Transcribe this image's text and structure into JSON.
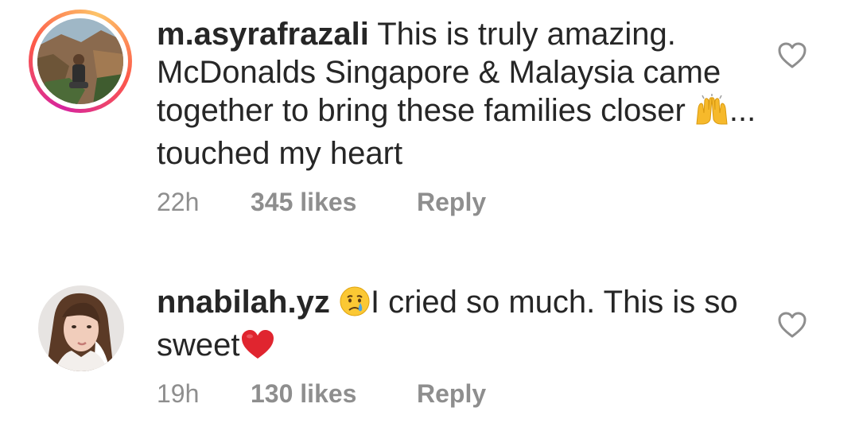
{
  "comments": [
    {
      "username": "m.asyrafrazali",
      "text_before_emoji": "This is truly amazing. McDonalds Singapore & Malaysia came together to bring these families closer ",
      "emoji": "raising-hands-icon",
      "text_after_emoji": "... touched my heart",
      "time": "22h",
      "likes": "345 likes",
      "reply_label": "Reply",
      "has_story_ring": true,
      "like_icon": "heart-outline-icon"
    },
    {
      "username": "nnabilah.yz",
      "emoji": "crying-face-icon",
      "text_after_emoji": "I cried so much. This is so sweet",
      "trailing_emoji": "red-heart-icon",
      "time": "19h",
      "likes": "130 likes",
      "reply_label": "Reply",
      "has_story_ring": false,
      "like_icon": "heart-outline-icon"
    }
  ],
  "colors": {
    "text": "#262626",
    "meta": "#8e8e8e",
    "heart_red": "#e0252f"
  }
}
